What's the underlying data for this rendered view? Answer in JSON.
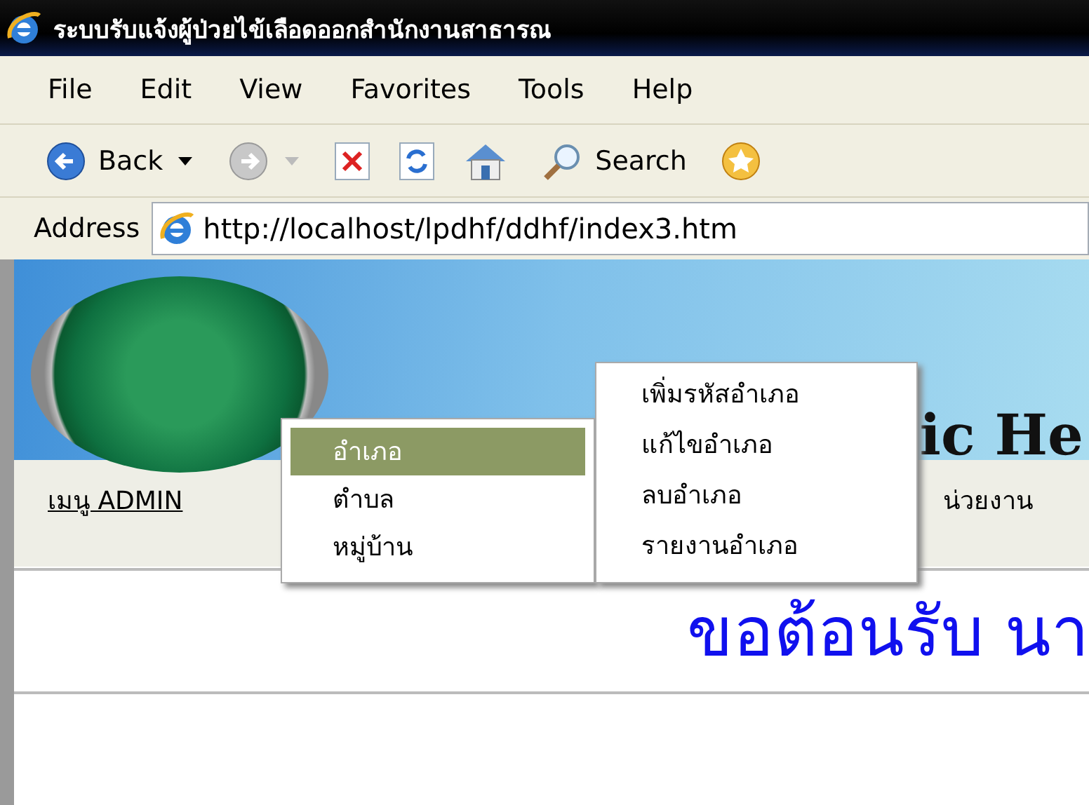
{
  "window": {
    "title": "ระบบรับแจ้งผู้ป่วยไข้เลือดออกสำนักงานสาธารณ"
  },
  "menu_bar": [
    "File",
    "Edit",
    "View",
    "Favorites",
    "Tools",
    "Help"
  ],
  "toolbar": {
    "back": "Back",
    "search": "Search"
  },
  "address": {
    "label": "Address",
    "url": "http://localhost/lpdhf/ddhf/index3.htm"
  },
  "banner": {
    "title": "ic He"
  },
  "nav": {
    "items": [
      "เมนู ADMIN",
      "น่วยงาน"
    ]
  },
  "dropdown": {
    "items": [
      {
        "label": "อำเภอ",
        "selected": true
      },
      {
        "label": "ตำบล",
        "selected": false
      },
      {
        "label": "หมู่บ้าน",
        "selected": false
      }
    ]
  },
  "submenu": {
    "items": [
      "เพิ่มรหัสอำเภอ",
      "แก้ไขอำเภอ",
      "ลบอำเภอ",
      "รายงานอำเภอ"
    ]
  },
  "welcome": "ขอต้อนรับ นา"
}
